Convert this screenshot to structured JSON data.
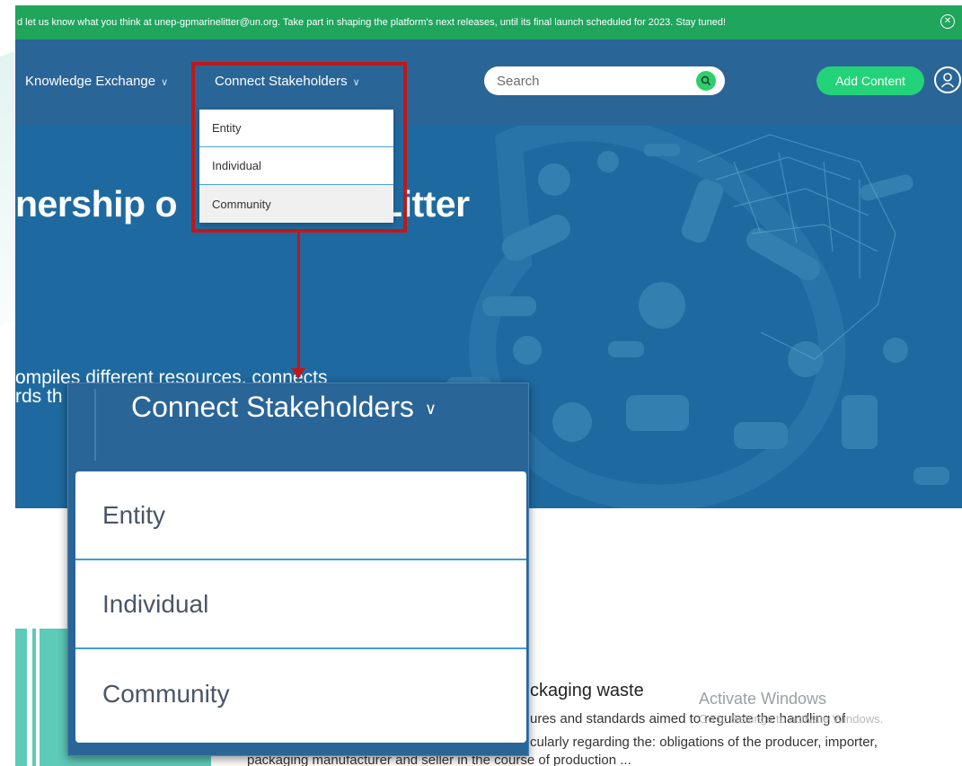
{
  "banner": {
    "text": "d let us know what you think at unep-gpmarinelitter@un.org. Take part in shaping the platform's next releases, until its final launch scheduled for 2023. Stay tuned!",
    "close_icon": "close-circle-icon"
  },
  "nav": {
    "knowledge_label": "Knowledge Exchange",
    "connect_label": "Connect Stakeholders",
    "search_placeholder": "Search",
    "add_content_label": "Add Content",
    "user_icon": "user-icon"
  },
  "hero": {
    "title_left": "nership o",
    "title_right": "Litter",
    "subtitle_line1": "ompiles different resources, connects",
    "subtitle_line2": "rds th"
  },
  "dropdown": {
    "items": [
      "Entity",
      "Individual",
      "Community"
    ]
  },
  "zoom": {
    "title": "Connect Stakeholders",
    "items": [
      "Entity",
      "Individual",
      "Community"
    ]
  },
  "article": {
    "title": "ckaging waste",
    "line1": "ures and standards aimed to regulate the handling of",
    "line2": "cularly regarding the: obligations of the producer, importer,",
    "line3": "packaging manufacturer and seller in the course of production ..."
  },
  "watermark": {
    "title": "Activate Windows",
    "subtitle": "Go to Settings to activate Windows."
  },
  "colors": {
    "banner": "#1fa55c",
    "header": "#2a6597",
    "hero": "#1e6aa0",
    "accent_green": "#22d37a",
    "highlight_red": "#c01818"
  }
}
